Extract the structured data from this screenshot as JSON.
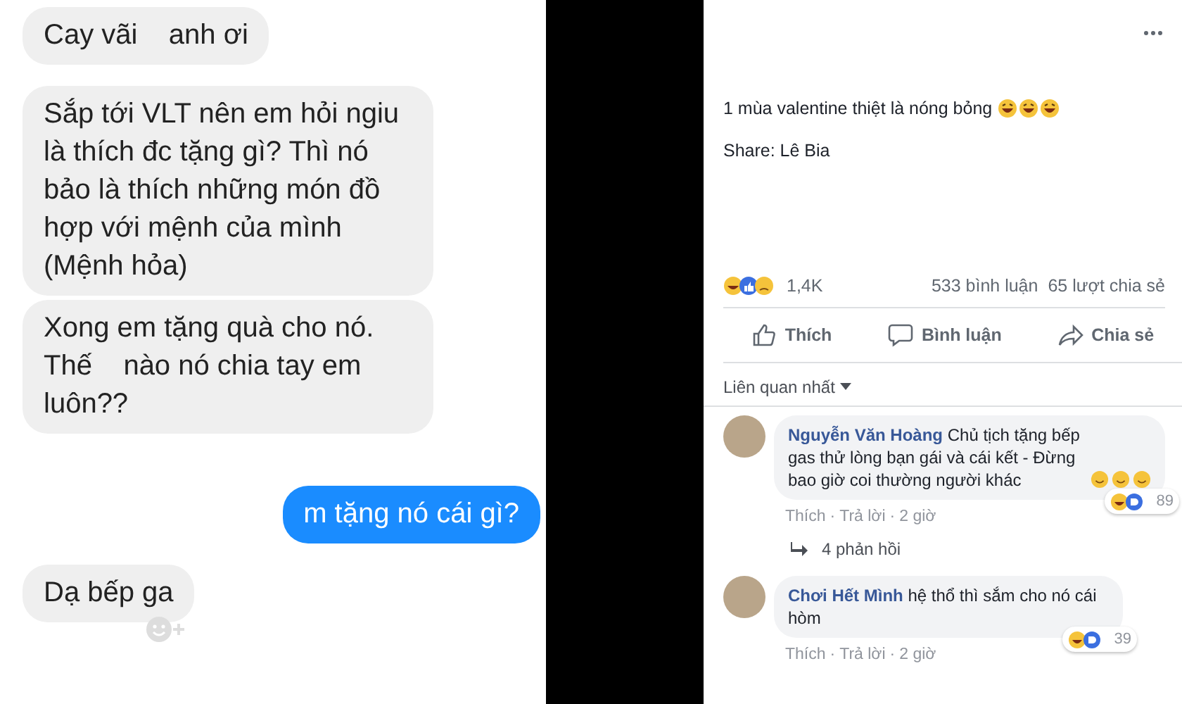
{
  "chat": {
    "messages": [
      {
        "kind": "received",
        "text": "Cay vãi    anh ơi"
      },
      {
        "kind": "received",
        "text": "Sắp tới VLT nên em hỏi ngiu là thích đc tặng gì? Thì nó bảo là thích những món đồ hợp với mệnh của mình (Mệnh hỏa)"
      },
      {
        "kind": "received",
        "text": "Xong em tặng quà cho nó. Thế    nào nó chia tay em luôn??"
      },
      {
        "kind": "sent",
        "text": "m tặng nó cái gì?"
      },
      {
        "kind": "received",
        "text": "Dạ bếp ga"
      }
    ]
  },
  "post": {
    "text": "1 mùa valentine thiệt là nóng bỏng",
    "share": "Share: Lê Bia",
    "reactions_count": "1,4K",
    "comments_count": "533 bình luận",
    "shares_count": "65 lượt chia sẻ",
    "actions": [
      {
        "kind": "like",
        "label": "Thích"
      },
      {
        "kind": "comment",
        "label": "Bình luận"
      },
      {
        "kind": "share",
        "label": "Chia sẻ"
      }
    ],
    "sort": "Liên quan nhất",
    "separator": "·",
    "comments": [
      {
        "author": "Nguyễn Văn Hoàng",
        "text": "Chủ tịch tặng bếp gas thử lòng bạn gái và cái kết - Đừng bao giờ coi thường người khác",
        "like": "Thích",
        "reply": "Trả lời",
        "time": "2 giờ",
        "reaction_count": "89",
        "replies": "4 phản hồi"
      },
      {
        "author": "Chơi Hết Mình",
        "text": "hệ thổ thì sắm cho nó cái hòm",
        "like": "Thích",
        "reply": "Trả lời",
        "time": "2 giờ",
        "reaction_count": "39"
      }
    ]
  }
}
